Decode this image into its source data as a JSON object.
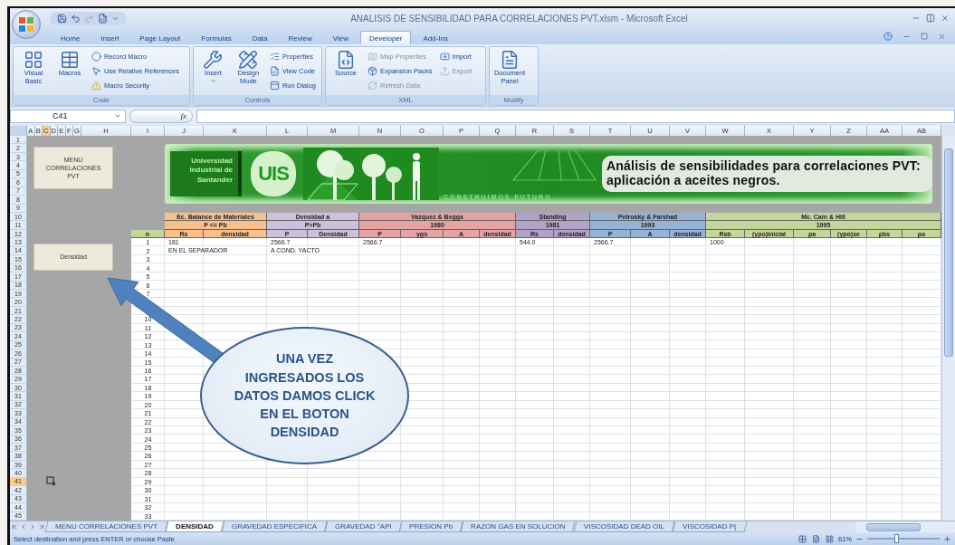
{
  "window": {
    "title": "ANALISIS DE SENSIBILIDAD PARA CORRELACIONES PVT.xlsm - Microsoft Excel"
  },
  "ribbon": {
    "tabs": [
      {
        "label": "Home",
        "selected": false
      },
      {
        "label": "Insert",
        "selected": false
      },
      {
        "label": "Page Layout",
        "selected": false
      },
      {
        "label": "Formulas",
        "selected": false
      },
      {
        "label": "Data",
        "selected": false
      },
      {
        "label": "Review",
        "selected": false
      },
      {
        "label": "View",
        "selected": false
      },
      {
        "label": "Developer",
        "selected": true
      },
      {
        "label": "Add-Ins",
        "selected": false
      }
    ],
    "groups": [
      {
        "label": "Code",
        "large": [
          {
            "label": "Visual Basic",
            "dropdown": false
          },
          {
            "label": "Macros",
            "dropdown": false
          }
        ],
        "small_columns": [
          [
            {
              "label": "Record Macro",
              "disabled": false
            },
            {
              "label": "Use Relative References",
              "disabled": false
            },
            {
              "label": "Macro Security",
              "disabled": false
            }
          ]
        ]
      },
      {
        "label": "Controls",
        "large": [
          {
            "label": "Insert",
            "dropdown": true
          },
          {
            "label": "Design Mode",
            "dropdown": false
          }
        ],
        "small_columns": [
          [
            {
              "label": "Properties",
              "disabled": false
            },
            {
              "label": "View Code",
              "disabled": false
            },
            {
              "label": "Run Dialog",
              "disabled": false
            }
          ]
        ]
      },
      {
        "label": "XML",
        "large": [
          {
            "label": "Source",
            "dropdown": false
          }
        ],
        "small_columns": [
          [
            {
              "label": "Map Properties",
              "disabled": true
            },
            {
              "label": "Expansion Packs",
              "disabled": false
            },
            {
              "label": "Refresh Data",
              "disabled": true
            }
          ],
          [
            {
              "label": "Import",
              "disabled": false
            },
            {
              "label": "Export",
              "disabled": true
            }
          ]
        ]
      },
      {
        "label": "Modify",
        "large": [
          {
            "label": "Document Panel",
            "dropdown": false
          }
        ]
      }
    ]
  },
  "formula_bar": {
    "name_box": "C41",
    "function_label": "fx"
  },
  "columns": [
    {
      "label": "A",
      "selected": false
    },
    {
      "label": "B",
      "selected": false
    },
    {
      "label": "C",
      "selected": true
    },
    {
      "label": "D",
      "selected": false
    },
    {
      "label": "E",
      "selected": false
    },
    {
      "label": "F",
      "selected": false
    },
    {
      "label": "G",
      "selected": false
    },
    {
      "label": "H",
      "selected": false
    },
    {
      "label": "I",
      "selected": false
    },
    {
      "label": "J",
      "selected": false
    },
    {
      "label": "K",
      "selected": false
    },
    {
      "label": "L",
      "selected": false
    },
    {
      "label": "M",
      "selected": false
    },
    {
      "label": "N",
      "selected": false
    },
    {
      "label": "O",
      "selected": false
    },
    {
      "label": "P",
      "selected": false
    },
    {
      "label": "Q",
      "selected": false
    },
    {
      "label": "R",
      "selected": false
    },
    {
      "label": "S",
      "selected": false
    },
    {
      "label": "T",
      "selected": false
    },
    {
      "label": "U",
      "selected": false
    },
    {
      "label": "V",
      "selected": false
    },
    {
      "label": "W",
      "selected": false
    },
    {
      "label": "X",
      "selected": false
    },
    {
      "label": "Y",
      "selected": false
    },
    {
      "label": "Z",
      "selected": false
    },
    {
      "label": "AA",
      "selected": false
    },
    {
      "label": "AB",
      "selected": false
    }
  ],
  "row_headers": [
    {
      "label": "1",
      "selected": false
    },
    {
      "label": "2",
      "selected": false
    },
    {
      "label": "3",
      "selected": false
    },
    {
      "label": "4",
      "selected": false
    },
    {
      "label": "5",
      "selected": false
    },
    {
      "label": "6",
      "selected": false
    },
    {
      "label": "7",
      "selected": false
    },
    {
      "label": "8",
      "selected": false
    },
    {
      "label": "9",
      "selected": false
    },
    {
      "label": "10",
      "selected": false
    },
    {
      "label": "11",
      "selected": false
    },
    {
      "label": "12",
      "selected": false
    },
    {
      "label": "13",
      "selected": false
    },
    {
      "label": "14",
      "selected": false
    },
    {
      "label": "15",
      "selected": false
    },
    {
      "label": "16",
      "selected": false
    },
    {
      "label": "17",
      "selected": false
    },
    {
      "label": "18",
      "selected": false
    },
    {
      "label": "19",
      "selected": false
    },
    {
      "label": "20",
      "selected": false
    },
    {
      "label": "21",
      "selected": false
    },
    {
      "label": "22",
      "selected": false
    },
    {
      "label": "23",
      "selected": false
    },
    {
      "label": "24",
      "selected": false
    },
    {
      "label": "25",
      "selected": false
    },
    {
      "label": "26",
      "selected": false
    },
    {
      "label": "27",
      "selected": false
    },
    {
      "label": "28",
      "selected": false
    },
    {
      "label": "29",
      "selected": false
    },
    {
      "label": "30",
      "selected": false
    },
    {
      "label": "31",
      "selected": false
    },
    {
      "label": "32",
      "selected": false
    },
    {
      "label": "33",
      "selected": false
    },
    {
      "label": "34",
      "selected": false
    },
    {
      "label": "35",
      "selected": false
    },
    {
      "label": "36",
      "selected": false
    },
    {
      "label": "37",
      "selected": false
    },
    {
      "label": "38",
      "selected": false
    },
    {
      "label": "39",
      "selected": false
    },
    {
      "label": "40",
      "selected": false
    },
    {
      "label": "41",
      "selected": true
    },
    {
      "label": "42",
      "selected": false
    },
    {
      "label": "43",
      "selected": false
    },
    {
      "label": "44",
      "selected": false
    },
    {
      "label": "45",
      "selected": false
    }
  ],
  "sheet": {
    "buttons": [
      "MENU CORRELACIONES PVT",
      "Densidad"
    ],
    "banner": {
      "university": "Universidad Industrial de Santander",
      "logo": "UIS",
      "motto": "CONSTRUIMOS FUTURO",
      "headline": "Análisis de sensibilidades para correlaciones PVT: aplicación a aceites negros."
    },
    "table": {
      "index_header": "n",
      "groups": [
        {
          "label": "Ec. Balance de Materiales",
          "subtitle": "P <= Pb",
          "color": "#f9c08e",
          "columns": [
            "Rs",
            "densidad"
          ]
        },
        {
          "label": "Densidad a",
          "subtitle": "P>Pb",
          "color": "#ccc0da",
          "columns": [
            "P",
            "Densidad"
          ]
        },
        {
          "label": "Vazquez & Beggs",
          "subtitle": "1980",
          "color": "#e6a3a3",
          "columns": [
            "P",
            "γgs",
            "A",
            "densidad"
          ]
        },
        {
          "label": "Standing",
          "subtitle": "1981",
          "color": "#b3a2c8",
          "columns": [
            "Rs",
            "densidad"
          ]
        },
        {
          "label": "Petrosky & Farshad",
          "subtitle": "1993",
          "color": "#95b3d7",
          "columns": [
            "P",
            "A",
            "densidad"
          ]
        },
        {
          "label": "Mc. Cain & Hill",
          "subtitle": "1995",
          "color": "#c4d79b",
          "columns": [
            "Rsb",
            "(γpo)inicial",
            "ρa",
            "(γpo)se",
            "ρbs",
            "ρo"
          ]
        }
      ],
      "rows": [
        {
          "n": "1",
          "cells": [
            "181",
            null,
            "2566.7",
            null,
            "2566.7",
            null,
            null,
            null,
            "544.0",
            null,
            "2566.7",
            null,
            null,
            "1000"
          ]
        },
        {
          "n": "2",
          "cells": [
            "EN EL SEPARADOR",
            null,
            "A COND. YACTO"
          ]
        },
        {
          "n": "3"
        },
        {
          "n": "4"
        },
        {
          "n": "5"
        },
        {
          "n": "6"
        },
        {
          "n": "7"
        },
        {},
        {},
        {
          "n": "10"
        },
        {
          "n": "11"
        },
        {
          "n": "12"
        },
        {
          "n": "13"
        },
        {
          "n": "14"
        },
        {
          "n": "15"
        },
        {
          "n": "16"
        },
        {
          "n": "17"
        },
        {
          "n": "18"
        },
        {
          "n": "19"
        },
        {
          "n": "20"
        },
        {
          "n": "21"
        },
        {
          "n": "22"
        },
        {
          "n": "23"
        },
        {
          "n": "24"
        },
        {
          "n": "25"
        },
        {
          "n": "26"
        },
        {
          "n": "27"
        },
        {
          "n": "28"
        },
        {
          "n": "29"
        },
        {
          "n": "30"
        },
        {
          "n": "31"
        },
        {
          "n": "32"
        },
        {
          "n": "33"
        }
      ]
    },
    "callout": {
      "lines": [
        "UNA VEZ",
        "INGRESADOS LOS",
        "DATOS DAMOS CLICK",
        "EN EL BOTON",
        "DENSIDAD"
      ]
    }
  },
  "sheet_tabs": [
    {
      "label": "MENU CORRELACIONES PVT",
      "selected": false
    },
    {
      "label": "DENSIDAD",
      "selected": true
    },
    {
      "label": "GRAVEDAD ESPECIFICA",
      "selected": false
    },
    {
      "label": "GRAVEDAD °API",
      "selected": false
    },
    {
      "label": "PRESION Pb",
      "selected": false
    },
    {
      "label": "RAZON GAS EN SOLUCION",
      "selected": false
    },
    {
      "label": "VISCOSIDAD DEAD OIL",
      "selected": false
    },
    {
      "label": "VISCOSIDAD P(",
      "selected": false
    }
  ],
  "status_bar": {
    "message": "Select destination and press ENTER or choose Paste",
    "zoom": "61%",
    "zoom_slider": {
      "level": 0.4
    }
  }
}
